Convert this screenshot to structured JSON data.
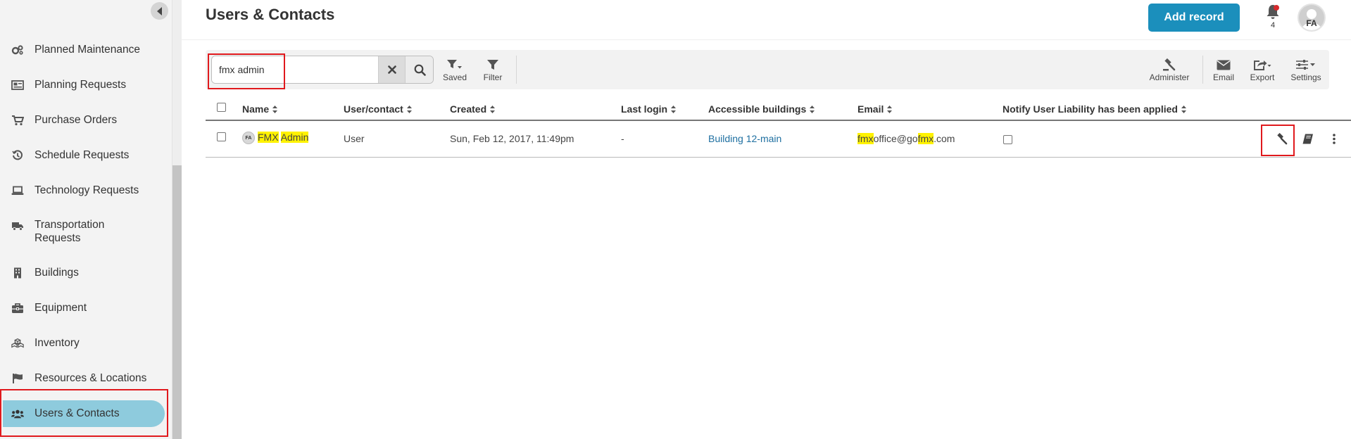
{
  "page": {
    "title": "Users & Contacts"
  },
  "header": {
    "add_record_label": "Add record",
    "notification_count": "4",
    "avatar_initials": "FA"
  },
  "sidebar": {
    "items": [
      {
        "label": "Planned Maintenance",
        "icon": "gears-icon"
      },
      {
        "label": "Planning Requests",
        "icon": "newspaper-icon"
      },
      {
        "label": "Purchase Orders",
        "icon": "cart-icon"
      },
      {
        "label": "Schedule Requests",
        "icon": "history-icon"
      },
      {
        "label": "Technology Requests",
        "icon": "laptop-icon"
      },
      {
        "label": "Transportation Requests",
        "icon": "truck-icon"
      },
      {
        "label": "Buildings",
        "icon": "building-icon"
      },
      {
        "label": "Equipment",
        "icon": "toolbox-icon"
      },
      {
        "label": "Inventory",
        "icon": "cubes-icon"
      },
      {
        "label": "Resources & Locations",
        "icon": "flag-icon"
      },
      {
        "label": "Users & Contacts",
        "icon": "users-icon",
        "active": true
      }
    ]
  },
  "toolbar": {
    "search_value": "fmx admin",
    "saved_label": "Saved",
    "filter_label": "Filter",
    "administer_label": "Administer",
    "email_label": "Email",
    "export_label": "Export",
    "settings_label": "Settings"
  },
  "table": {
    "columns": [
      "Name",
      "User/contact",
      "Created",
      "Last login",
      "Accessible buildings",
      "Email",
      "Notify User Liability has been applied"
    ],
    "rows": [
      {
        "avatar": "FA",
        "name_part1": "FMX",
        "name_part2": "Admin",
        "type": "User",
        "created": "Sun, Feb 12, 2017, 11:49pm",
        "last_login": "-",
        "buildings": "Building 12-main",
        "email_part1": "fmx",
        "email_part2": "office@go",
        "email_part3": "fmx",
        "email_part4": ".com"
      }
    ]
  },
  "colors": {
    "accent": "#1b8fbc",
    "active_nav": "#8ecbdd",
    "highlight": "#fff200",
    "annotation": "#e0191d"
  }
}
